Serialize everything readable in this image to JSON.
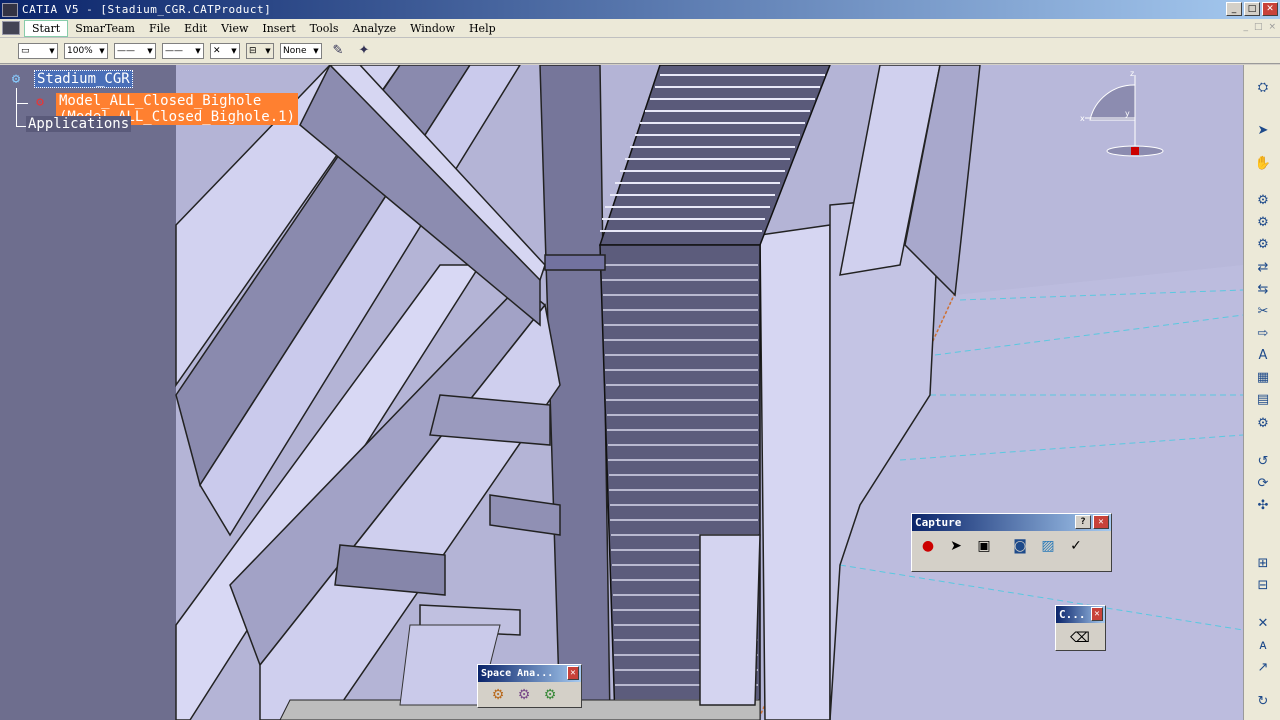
{
  "window": {
    "title": "CATIA V5 - [Stadium_CGR.CATProduct]",
    "min_label": "_",
    "max_label": "□",
    "close_label": "✕"
  },
  "menu": {
    "items": [
      "Start",
      "SmarTeam",
      "File",
      "Edit",
      "View",
      "Insert",
      "Tools",
      "Analyze",
      "Window",
      "Help"
    ],
    "doc_controls": [
      "_",
      "□",
      "×"
    ]
  },
  "toolbar": {
    "zoom_value": "100%",
    "layer_value": "None",
    "line_type": "——",
    "line_weight": "——",
    "point_style": "✕"
  },
  "tree": {
    "root": "Stadium_CGR",
    "child": "Model_ALL_Closed_Bighole (Model_ALL_Closed_Bighole.1)",
    "applications": "Applications"
  },
  "compass": {
    "x_label": "x",
    "y_label": "y",
    "z_label": "z"
  },
  "capture_toolbar": {
    "title": "Capture",
    "help_label": "?",
    "close_label": "✕"
  },
  "c_toolbar": {
    "title": "C...",
    "close_label": "✕"
  },
  "space_toolbar": {
    "title": "Space Ana...",
    "close_label": "✕"
  },
  "colors": {
    "tree_root_bg": "#4a6fb8",
    "tree_child_bg": "#ff8030",
    "viewport_bg": "#b4b4d6",
    "structure_dark": "#6a6a8a",
    "structure_light": "#c8c8ea"
  }
}
